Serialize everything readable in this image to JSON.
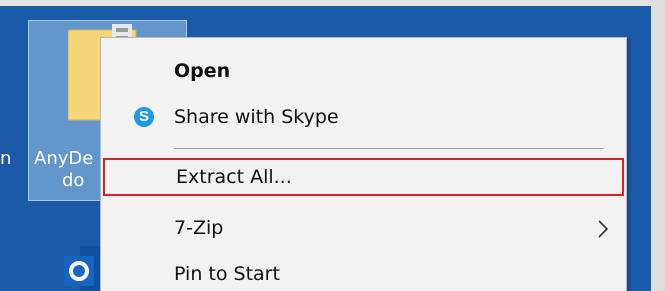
{
  "desktop": {
    "selected_icon": {
      "label_line1": "AnyDe",
      "label_line2": "do"
    },
    "left_fragment": "n"
  },
  "context_menu": {
    "items": [
      {
        "label": "Open",
        "bold": true
      },
      {
        "label": "Share with Skype",
        "icon": "skype-icon"
      },
      {
        "label": "Extract All...",
        "highlighted": true
      },
      {
        "label": "7-Zip",
        "has_submenu": true
      },
      {
        "label": "Pin to Start"
      }
    ]
  },
  "colors": {
    "desktop_blue": "#1a5aa8",
    "menu_bg": "#f2f2f2",
    "highlight_border": "#e02020",
    "skype_blue": "#1d9be8"
  }
}
